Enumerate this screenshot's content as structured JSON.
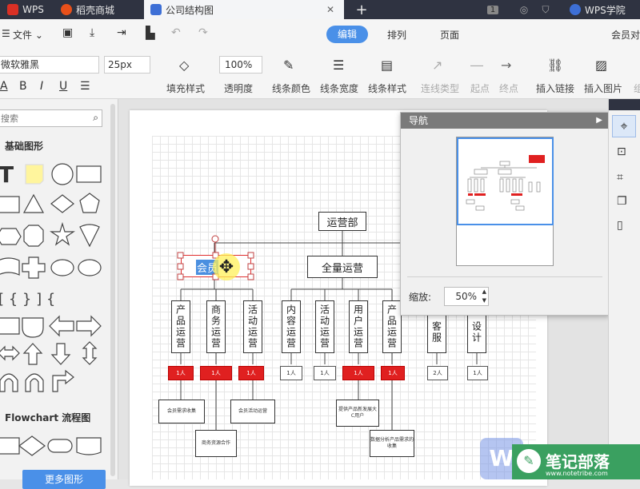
{
  "tabs": [
    {
      "label": "WPS",
      "color": "#d93025"
    },
    {
      "label": "稻壳商城",
      "color": "#e8501a"
    },
    {
      "label": "公司结构图",
      "color": "#3d6fd6"
    }
  ],
  "tab_counter": "1",
  "wps_academy": "WPS学院",
  "file_menu": "文件",
  "mode_tabs": [
    {
      "label": "编辑",
      "active": true
    },
    {
      "label": "排列",
      "active": false
    },
    {
      "label": "页面",
      "active": false
    }
  ],
  "member_link": "会员对",
  "font": {
    "name": "微软雅黑",
    "size": "25px"
  },
  "opacity_value": "100%",
  "toolbar": {
    "fill": "填充样式",
    "opacity": "透明度",
    "line_color": "线条颜色",
    "line_width": "线条宽度",
    "line_style": "线条样式",
    "connector": "连线类型",
    "start": "起点",
    "end": "终点",
    "insert_link": "插入链接",
    "insert_image": "插入图片",
    "group_partial": "组"
  },
  "sidebar": {
    "search_placeholder": "搜索",
    "basic_shapes": "基础图形",
    "flowchart": "Flowchart 流程图",
    "more_shapes": "更多图形"
  },
  "nav": {
    "title": "导航",
    "zoom_label": "缩放:",
    "zoom_value": "50%"
  },
  "chart": {
    "root": "运营部",
    "level2": "全量运营",
    "selected": "会员",
    "columns": [
      {
        "text": "产品运营",
        "badge": "1人",
        "badge_red": true
      },
      {
        "text": "商务运营",
        "badge": "1人",
        "badge_red": true
      },
      {
        "text": "活动运营",
        "badge": "1人",
        "badge_red": true
      },
      {
        "text": "内容运营",
        "badge": "1人",
        "badge_red": false
      },
      {
        "text": "活动运营",
        "badge": "1人",
        "badge_red": false
      },
      {
        "text": "用户运营",
        "badge": "1人",
        "badge_red": true
      },
      {
        "text": "产品运营",
        "badge": "1人",
        "badge_red": true
      },
      {
        "text": "客服",
        "badge": "2人",
        "badge_red": false
      },
      {
        "text": "设计",
        "badge": "1人",
        "badge_red": false
      }
    ],
    "subs": [
      "会员需求收集",
      "商务资源合作",
      "会员活动运营",
      "提供产品新发展大C用户",
      "数据分析产品需求的收集"
    ]
  },
  "watermark": {
    "text": "笔记部落",
    "url": "www.notetribe.com"
  }
}
